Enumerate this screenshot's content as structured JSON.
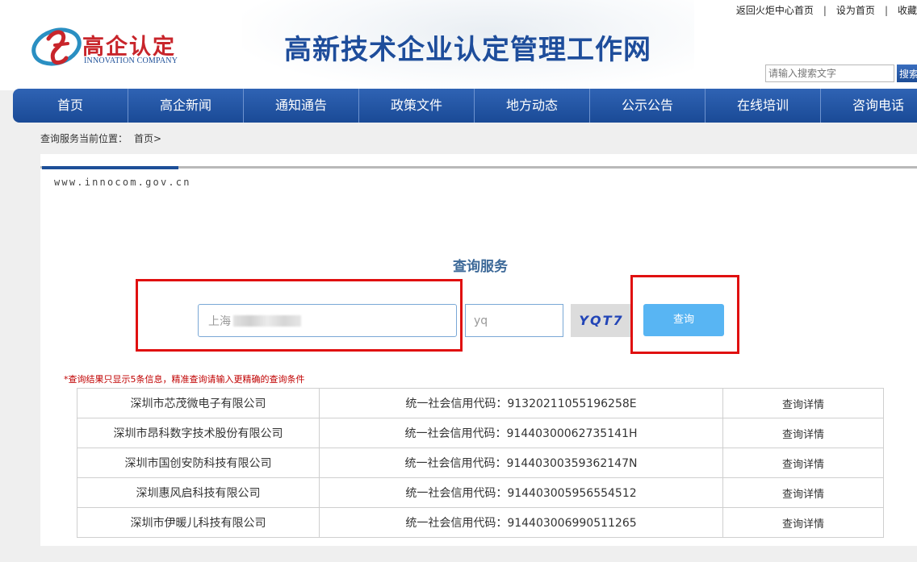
{
  "header": {
    "logo_cn": "高企认定",
    "logo_en": "INNOVATION COMPANY",
    "site_title": "高新技术企业认定管理工作网",
    "top_links": [
      "返回火炬中心首页",
      "设为首页",
      "收藏"
    ],
    "search_placeholder": "请输入搜索文字",
    "search_button": "搜索"
  },
  "nav": {
    "items": [
      "首页",
      "高企新闻",
      "通知通告",
      "政策文件",
      "地方动态",
      "公示公告",
      "在线培训",
      "咨询电话"
    ]
  },
  "breadcrumb": {
    "label": "查询服务当前位置：",
    "current": "首页>"
  },
  "main": {
    "url_text": "www.innocom.gov.cn",
    "service_title": "查询服务",
    "query_value": "上海",
    "code_value": "yq",
    "captcha": "YQT7",
    "query_button": "查询",
    "notice": "*查询结果只显示5条信息，精准查询请输入更精确的查询条件",
    "code_prefix": "统一社会信用代码：",
    "detail_label": "查询详情",
    "results": [
      {
        "name": "深圳市芯茂微电子有限公司",
        "code": "91320211055196258E"
      },
      {
        "name": "深圳市昂科数字技术股份有限公司",
        "code": "91440300062735141H"
      },
      {
        "name": "深圳市国创安防科技有限公司",
        "code": "91440300359362147N"
      },
      {
        "name": "深圳惠风启科技有限公司",
        "code": "914403005956554512"
      },
      {
        "name": "深圳市伊暖儿科技有限公司",
        "code": "914403006990511265"
      }
    ]
  },
  "colors": {
    "nav_blue": "#1e4d9b",
    "highlight_red": "#e01010",
    "button_blue": "#58b5f3",
    "notice_red": "#c00000"
  }
}
